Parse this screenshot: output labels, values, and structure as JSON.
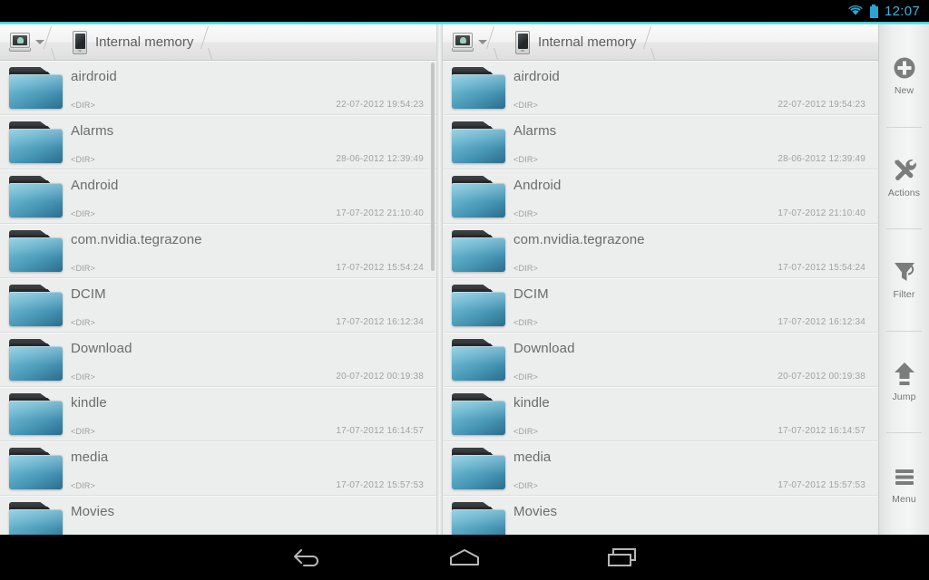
{
  "status_bar": {
    "wifi_icon": "wifi-icon",
    "battery_icon": "battery-icon",
    "time": "12:07",
    "accent_color": "#3ec8cd",
    "icon_color": "#3fb3dd"
  },
  "panels": [
    {
      "id": "left",
      "breadcrumb": {
        "root_icon": "computer-icon",
        "dropdown_icon": "chevron-down-icon",
        "device_icon": "phone-icon",
        "label": "Internal memory"
      },
      "rows": [
        {
          "name": "airdroid",
          "type": "<DIR>",
          "date": "22-07-2012 19:54:23",
          "icon": "folder-icon"
        },
        {
          "name": "Alarms",
          "type": "<DIR>",
          "date": "28-06-2012 12:39:49",
          "icon": "folder-icon"
        },
        {
          "name": "Android",
          "type": "<DIR>",
          "date": "17-07-2012 21:10:40",
          "icon": "folder-icon"
        },
        {
          "name": "com.nvidia.tegrazone",
          "type": "<DIR>",
          "date": "17-07-2012 15:54:24",
          "icon": "folder-icon"
        },
        {
          "name": "DCIM",
          "type": "<DIR>",
          "date": "17-07-2012 16:12:34",
          "icon": "folder-icon"
        },
        {
          "name": "Download",
          "type": "<DIR>",
          "date": "20-07-2012 00:19:38",
          "icon": "folder-icon"
        },
        {
          "name": "kindle",
          "type": "<DIR>",
          "date": "17-07-2012 16:14:57",
          "icon": "folder-icon"
        },
        {
          "name": "media",
          "type": "<DIR>",
          "date": "17-07-2012 15:57:53",
          "icon": "folder-icon"
        },
        {
          "name": "Movies",
          "type": "",
          "date": "",
          "icon": "folder-icon"
        }
      ]
    },
    {
      "id": "right",
      "breadcrumb": {
        "root_icon": "computer-icon",
        "dropdown_icon": "chevron-down-icon",
        "device_icon": "phone-icon",
        "label": "Internal memory"
      },
      "rows": [
        {
          "name": "airdroid",
          "type": "<DIR>",
          "date": "22-07-2012 19:54:23",
          "icon": "folder-icon"
        },
        {
          "name": "Alarms",
          "type": "<DIR>",
          "date": "28-06-2012 12:39:49",
          "icon": "folder-icon"
        },
        {
          "name": "Android",
          "type": "<DIR>",
          "date": "17-07-2012 21:10:40",
          "icon": "folder-icon"
        },
        {
          "name": "com.nvidia.tegrazone",
          "type": "<DIR>",
          "date": "17-07-2012 15:54:24",
          "icon": "folder-icon"
        },
        {
          "name": "DCIM",
          "type": "<DIR>",
          "date": "17-07-2012 16:12:34",
          "icon": "folder-icon"
        },
        {
          "name": "Download",
          "type": "<DIR>",
          "date": "20-07-2012 00:19:38",
          "icon": "folder-icon"
        },
        {
          "name": "kindle",
          "type": "<DIR>",
          "date": "17-07-2012 16:14:57",
          "icon": "folder-icon"
        },
        {
          "name": "media",
          "type": "<DIR>",
          "date": "17-07-2012 15:57:53",
          "icon": "folder-icon"
        },
        {
          "name": "Movies",
          "type": "",
          "date": "",
          "icon": "folder-icon"
        }
      ]
    }
  ],
  "sidebar": {
    "items": [
      {
        "label": "New",
        "icon": "plus-circle-icon"
      },
      {
        "label": "Actions",
        "icon": "tools-icon"
      },
      {
        "label": "Filter",
        "icon": "funnel-icon"
      },
      {
        "label": "Jump",
        "icon": "arrow-up-icon"
      },
      {
        "label": "Menu",
        "icon": "hamburger-icon"
      }
    ]
  },
  "navigation_bar": {
    "back": "back-icon",
    "home": "home-icon",
    "recents": "recents-icon"
  }
}
